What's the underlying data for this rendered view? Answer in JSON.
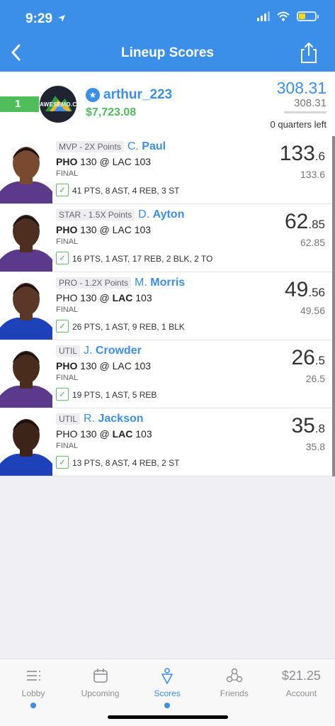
{
  "status_bar": {
    "time": "9:29"
  },
  "header": {
    "title": "Lineup Scores"
  },
  "summary": {
    "rank": "1",
    "logo_text": "AWESEMO.COM",
    "username": "arthur_223",
    "winnings": "$7,723.08",
    "total_score": "308.31",
    "total_score_sub": "308.31",
    "progress_fraction": 1.0,
    "quarters_left": "0 quarters left"
  },
  "players": [
    {
      "slot": "MVP - 2X Points",
      "initial": "C.",
      "last": "Paul",
      "team": "PHO",
      "team_score": "130",
      "at": "@",
      "opp": "LAC",
      "opp_score": "103",
      "bold": "team",
      "status": "FINAL",
      "stats": "41 PTS, 8 AST, 4 REB, 3 ST",
      "score_int": "133",
      "score_dec": ".6",
      "score_sub": "133.6"
    },
    {
      "slot": "STAR - 1.5X Points",
      "initial": "D.",
      "last": "Ayton",
      "team": "PHO",
      "team_score": "130",
      "at": "@",
      "opp": "LAC",
      "opp_score": "103",
      "bold": "team",
      "status": "FINAL",
      "stats": "16 PTS, 1 AST, 17 REB, 2 BLK, 2 TO",
      "score_int": "62",
      "score_dec": ".85",
      "score_sub": "62.85"
    },
    {
      "slot": "PRO - 1.2X Points",
      "initial": "M.",
      "last": "Morris",
      "team": "PHO",
      "team_score": "130",
      "at": "@",
      "opp": "LAC",
      "opp_score": "103",
      "bold": "opp",
      "status": "FINAL",
      "stats": "26 PTS, 1 AST, 9 REB, 1 BLK",
      "score_int": "49",
      "score_dec": ".56",
      "score_sub": "49.56"
    },
    {
      "slot": "UTIL",
      "initial": "J.",
      "last": "Crowder",
      "team": "PHO",
      "team_score": "130",
      "at": "@",
      "opp": "LAC",
      "opp_score": "103",
      "bold": "team",
      "status": "FINAL",
      "stats": "19 PTS, 1 AST, 5 REB",
      "score_int": "26",
      "score_dec": ".5",
      "score_sub": "26.5"
    },
    {
      "slot": "UTIL",
      "initial": "R.",
      "last": "Jackson",
      "team": "PHO",
      "team_score": "130",
      "at": "@",
      "opp": "LAC",
      "opp_score": "103",
      "bold": "opp",
      "status": "FINAL",
      "stats": "13 PTS, 8 AST, 4 REB, 2 ST",
      "score_int": "35",
      "score_dec": ".8",
      "score_sub": "35.8"
    }
  ],
  "tabs": [
    {
      "label": "Lobby",
      "icon": "list-icon",
      "dot": true
    },
    {
      "label": "Upcoming",
      "icon": "calendar-icon",
      "dot": false
    },
    {
      "label": "Scores",
      "icon": "scores-icon",
      "dot": true
    },
    {
      "label": "Friends",
      "icon": "friends-icon",
      "dot": false
    },
    {
      "label": "Account",
      "icon": "balance",
      "balance": "$21.25",
      "dot": false
    }
  ],
  "colors": {
    "brand": "#3b8fe9",
    "success": "#4fbd5a"
  }
}
